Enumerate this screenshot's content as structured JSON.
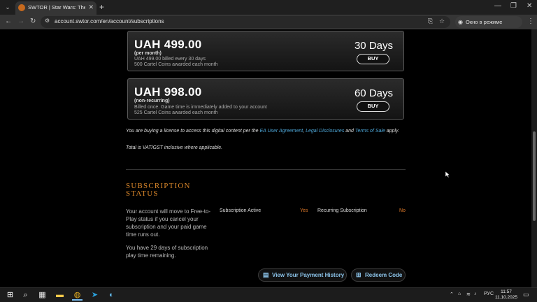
{
  "browser": {
    "tab_title": "SWTOR | Star Wars: The Old Re",
    "url": "account.swtor.com/en/account/subscriptions",
    "incognito_label": "Окно в режиме инкогнито"
  },
  "plans": [
    {
      "price": "UAH 499.00",
      "term": "(per month)",
      "desc1": "UAH 499.00 billed every 30 days",
      "desc2": "500 Cartel Coins awarded each month",
      "days": "30 Days",
      "buy_label": "BUY"
    },
    {
      "price": "UAH 998.00",
      "term": "(non-recurring)",
      "desc1": "Billed once. Game time is immediately added to your account",
      "desc2": "525 Cartel Coins awarded each month",
      "days": "60 Days",
      "buy_label": "BUY"
    }
  ],
  "legal": {
    "prefix": "You are buying a license to access this digital content per the ",
    "ea_link": "EA User Agreement",
    "sep1": ", ",
    "disclosures_link": "Legal Disclosures",
    "sep2": " and ",
    "terms_link": "Terms of Sale",
    "suffix": " apply.",
    "vat": "Total is VAT/GST inclusive where applicable."
  },
  "status": {
    "title_line1": "SUBSCRIPTION",
    "title_line2": "STATUS",
    "explain": "Your account will move to Free-to-Play status if you cancel your subscription and your paid game time runs out.",
    "remaining": "You have 29 days of subscription play time remaining.",
    "active_label": "Subscription Active",
    "active_value": "Yes",
    "recurring_label": "Recurring Subscription",
    "recurring_value": "No",
    "payment_history_label": "View Your Payment History",
    "redeem_label": "Redeem Code"
  },
  "taskbar": {
    "lang": "РУС",
    "time": "11:57",
    "date": "11.10.2025"
  },
  "colors": {
    "accent_orange": "#d9862a",
    "link_blue": "#4ea7d8"
  }
}
